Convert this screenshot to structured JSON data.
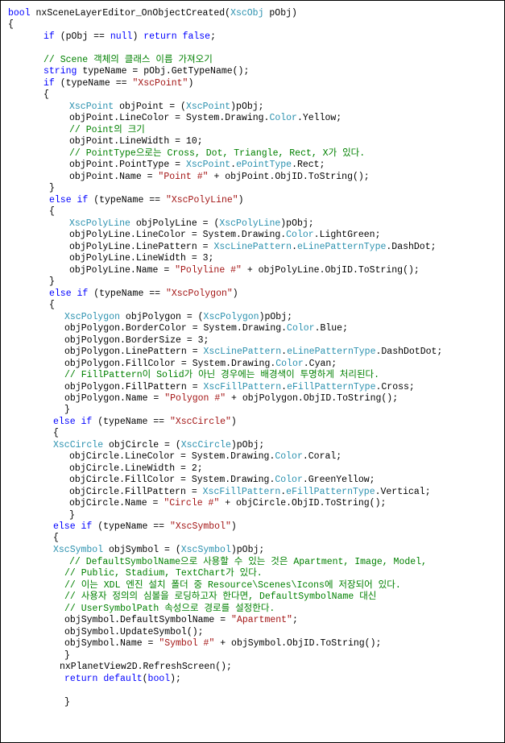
{
  "colors": {
    "keyword": "#0000ff",
    "type": "#2b91af",
    "string": "#a31515",
    "comment": "#008000",
    "text": "#000000",
    "background": "#ffffff"
  },
  "lines": [
    [
      {
        "t": "kw",
        "v": "bool"
      },
      {
        "t": "",
        "v": " nxSceneLayerEditor_OnObjectCreated("
      },
      {
        "t": "ty",
        "v": "XscObj"
      },
      {
        "t": "",
        "v": " pObj)"
      }
    ],
    [
      {
        "t": "",
        "v": "{"
      }
    ],
    [
      {
        "t": "kw",
        "v": "if"
      },
      {
        "t": "",
        "v": " (pObj == "
      },
      {
        "t": "kw",
        "v": "null"
      },
      {
        "t": "",
        "v": ") "
      },
      {
        "t": "kw",
        "v": "return"
      },
      {
        "t": "",
        "v": " "
      },
      {
        "t": "kw",
        "v": "false"
      },
      {
        "t": "",
        "v": ";"
      }
    ],
    [],
    [
      {
        "t": "cm",
        "v": "// Scene 객체의 클래스 이름 가져오기"
      }
    ],
    [
      {
        "t": "kw",
        "v": "string"
      },
      {
        "t": "",
        "v": " typeName = pObj.GetTypeName();"
      }
    ],
    [
      {
        "t": "kw",
        "v": "if"
      },
      {
        "t": "",
        "v": " (typeName == "
      },
      {
        "t": "str",
        "v": "\"XscPoint\""
      },
      {
        "t": "",
        "v": ")"
      }
    ],
    [
      {
        "t": "",
        "v": "{"
      }
    ],
    [
      {
        "t": "ty",
        "v": "XscPoint"
      },
      {
        "t": "",
        "v": " objPoint = ("
      },
      {
        "t": "ty",
        "v": "XscPoint"
      },
      {
        "t": "",
        "v": ")pObj;"
      }
    ],
    [
      {
        "t": "",
        "v": "objPoint.LineColor = System.Drawing."
      },
      {
        "t": "ty",
        "v": "Color"
      },
      {
        "t": "",
        "v": ".Yellow;"
      }
    ],
    [
      {
        "t": "cm",
        "v": "// Point의 크기"
      }
    ],
    [
      {
        "t": "",
        "v": "objPoint.LineWidth = 10;"
      }
    ],
    [
      {
        "t": "cm",
        "v": "// PointType으로는 Cross, Dot, Triangle, Rect, X가 있다."
      }
    ],
    [
      {
        "t": "",
        "v": "objPoint.PointType = "
      },
      {
        "t": "ty",
        "v": "XscPoint"
      },
      {
        "t": "",
        "v": "."
      },
      {
        "t": "ty",
        "v": "ePointType"
      },
      {
        "t": "",
        "v": ".Rect;"
      }
    ],
    [
      {
        "t": "",
        "v": "objPoint.Name = "
      },
      {
        "t": "str",
        "v": "\"Point #\""
      },
      {
        "t": "",
        "v": " + objPoint.ObjID.ToString();"
      }
    ],
    [
      {
        "t": "",
        "v": "}"
      }
    ],
    [
      {
        "t": "kw",
        "v": "else"
      },
      {
        "t": "",
        "v": " "
      },
      {
        "t": "kw",
        "v": "if"
      },
      {
        "t": "",
        "v": " (typeName == "
      },
      {
        "t": "str",
        "v": "\"XscPolyLine\""
      },
      {
        "t": "",
        "v": ")"
      }
    ],
    [
      {
        "t": "",
        "v": "{"
      }
    ],
    [
      {
        "t": "ty",
        "v": "XscPolyLine"
      },
      {
        "t": "",
        "v": " objPolyLine = ("
      },
      {
        "t": "ty",
        "v": "XscPolyLine"
      },
      {
        "t": "",
        "v": ")pObj;"
      }
    ],
    [
      {
        "t": "",
        "v": "objPolyLine.LineColor = System.Drawing."
      },
      {
        "t": "ty",
        "v": "Color"
      },
      {
        "t": "",
        "v": ".LightGreen;"
      }
    ],
    [
      {
        "t": "",
        "v": "objPolyLine.LinePattern = "
      },
      {
        "t": "ty",
        "v": "XscLinePattern"
      },
      {
        "t": "",
        "v": "."
      },
      {
        "t": "ty",
        "v": "eLinePatternType"
      },
      {
        "t": "",
        "v": ".DashDot;"
      }
    ],
    [
      {
        "t": "",
        "v": "objPolyLine.LineWidth = 3;"
      }
    ],
    [
      {
        "t": "",
        "v": "objPolyLine.Name = "
      },
      {
        "t": "str",
        "v": "\"Polyline #\""
      },
      {
        "t": "",
        "v": " + objPolyLine.ObjID.ToString();"
      }
    ],
    [
      {
        "t": "",
        "v": "}"
      }
    ],
    [
      {
        "t": "kw",
        "v": "else"
      },
      {
        "t": "",
        "v": " "
      },
      {
        "t": "kw",
        "v": "if"
      },
      {
        "t": "",
        "v": " (typeName == "
      },
      {
        "t": "str",
        "v": "\"XscPolygon\""
      },
      {
        "t": "",
        "v": ")"
      }
    ],
    [
      {
        "t": "",
        "v": "{"
      }
    ],
    [
      {
        "t": "ty",
        "v": "XscPolygon"
      },
      {
        "t": "",
        "v": " objPolygon = ("
      },
      {
        "t": "ty",
        "v": "XscPolygon"
      },
      {
        "t": "",
        "v": ")pObj;"
      }
    ],
    [
      {
        "t": "",
        "v": "objPolygon.BorderColor = System.Drawing."
      },
      {
        "t": "ty",
        "v": "Color"
      },
      {
        "t": "",
        "v": ".Blue;"
      }
    ],
    [
      {
        "t": "",
        "v": "objPolygon.BorderSize = 3;"
      }
    ],
    [
      {
        "t": "",
        "v": "objPolygon.LinePattern = "
      },
      {
        "t": "ty",
        "v": "XscLinePattern"
      },
      {
        "t": "",
        "v": "."
      },
      {
        "t": "ty",
        "v": "eLinePatternType"
      },
      {
        "t": "",
        "v": ".DashDotDot;"
      }
    ],
    [
      {
        "t": "",
        "v": "objPolygon.FillColor = System.Drawing."
      },
      {
        "t": "ty",
        "v": "Color"
      },
      {
        "t": "",
        "v": ".Cyan;"
      }
    ],
    [
      {
        "t": "cm",
        "v": "// FillPattern이 Solid가 아닌 경우에는 배경색이 투명하게 처리된다."
      }
    ],
    [
      {
        "t": "",
        "v": "objPolygon.FillPattern = "
      },
      {
        "t": "ty",
        "v": "XscFillPattern"
      },
      {
        "t": "",
        "v": "."
      },
      {
        "t": "ty",
        "v": "eFillPatternType"
      },
      {
        "t": "",
        "v": ".Cross;"
      }
    ],
    [
      {
        "t": "",
        "v": "objPolygon.Name = "
      },
      {
        "t": "str",
        "v": "\"Polygon #\""
      },
      {
        "t": "",
        "v": " + objPolygon.ObjID.ToString();"
      }
    ],
    [
      {
        "t": "",
        "v": "}"
      }
    ],
    [
      {
        "t": "kw",
        "v": "else"
      },
      {
        "t": "",
        "v": " "
      },
      {
        "t": "kw",
        "v": "if"
      },
      {
        "t": "",
        "v": " (typeName == "
      },
      {
        "t": "str",
        "v": "\"XscCircle\""
      },
      {
        "t": "",
        "v": ")"
      }
    ],
    [
      {
        "t": "",
        "v": "{"
      }
    ],
    [
      {
        "t": "ty",
        "v": "XscCircle"
      },
      {
        "t": "",
        "v": " objCircle = ("
      },
      {
        "t": "ty",
        "v": "XscCircle"
      },
      {
        "t": "",
        "v": ")pObj;"
      }
    ],
    [
      {
        "t": "",
        "v": "objCircle.LineColor = System.Drawing."
      },
      {
        "t": "ty",
        "v": "Color"
      },
      {
        "t": "",
        "v": ".Coral;"
      }
    ],
    [
      {
        "t": "",
        "v": "objCircle.LineWidth = 2;"
      }
    ],
    [
      {
        "t": "",
        "v": "objCircle.FillColor = System.Drawing."
      },
      {
        "t": "ty",
        "v": "Color"
      },
      {
        "t": "",
        "v": ".GreenYellow;"
      }
    ],
    [
      {
        "t": "",
        "v": "objCircle.FillPattern = "
      },
      {
        "t": "ty",
        "v": "XscFillPattern"
      },
      {
        "t": "",
        "v": "."
      },
      {
        "t": "ty",
        "v": "eFillPatternType"
      },
      {
        "t": "",
        "v": ".Vertical;"
      }
    ],
    [
      {
        "t": "",
        "v": "objCircle.Name = "
      },
      {
        "t": "str",
        "v": "\"Circle #\""
      },
      {
        "t": "",
        "v": " + objCircle.ObjID.ToString();"
      }
    ],
    [
      {
        "t": "",
        "v": "}"
      }
    ],
    [
      {
        "t": "kw",
        "v": "else"
      },
      {
        "t": "",
        "v": " "
      },
      {
        "t": "kw",
        "v": "if"
      },
      {
        "t": "",
        "v": " (typeName == "
      },
      {
        "t": "str",
        "v": "\"XscSymbol\""
      },
      {
        "t": "",
        "v": ")"
      }
    ],
    [
      {
        "t": "",
        "v": "{"
      }
    ],
    [
      {
        "t": "ty",
        "v": "XscSymbol"
      },
      {
        "t": "",
        "v": " objSymbol = ("
      },
      {
        "t": "ty",
        "v": "XscSymbol"
      },
      {
        "t": "",
        "v": ")pObj;"
      }
    ],
    [
      {
        "t": "cm",
        "v": "// DefaultSymbolName으로 사용할 수 있는 것은 Apartment, Image, Model,"
      }
    ],
    [
      {
        "t": "cm",
        "v": "// Public, Stadium, TextChart가 있다."
      }
    ],
    [
      {
        "t": "cm",
        "v": "// 이는 XDL 엔진 설치 폴더 중 Resource\\Scenes\\Icons에 저장되어 있다."
      }
    ],
    [
      {
        "t": "cm",
        "v": "// 사용자 정의의 심볼을 로딩하고자 한다면, DefaultSymbolName 대신"
      }
    ],
    [
      {
        "t": "cm",
        "v": "// UserSymbolPath 속성으로 경로를 설정한다."
      }
    ],
    [
      {
        "t": "",
        "v": "objSymbol.DefaultSymbolName = "
      },
      {
        "t": "str",
        "v": "\"Apartment\""
      },
      {
        "t": "",
        "v": ";"
      }
    ],
    [
      {
        "t": "",
        "v": "objSymbol.UpdateSymbol();"
      }
    ],
    [
      {
        "t": "",
        "v": "objSymbol.Name = "
      },
      {
        "t": "str",
        "v": "\"Symbol #\""
      },
      {
        "t": "",
        "v": " + objSymbol.ObjID.ToString();"
      }
    ],
    [
      {
        "t": "",
        "v": "}"
      }
    ],
    [
      {
        "t": "",
        "v": "nxPlanetView2D.RefreshScreen();"
      }
    ],
    [],
    [
      {
        "t": "kw",
        "v": "return"
      },
      {
        "t": "",
        "v": " "
      },
      {
        "t": "kw",
        "v": "default"
      },
      {
        "t": "",
        "v": "("
      },
      {
        "t": "kw",
        "v": "bool"
      },
      {
        "t": "",
        "v": ");"
      }
    ],
    [],
    [
      {
        "t": "",
        "v": "}"
      }
    ]
  ]
}
